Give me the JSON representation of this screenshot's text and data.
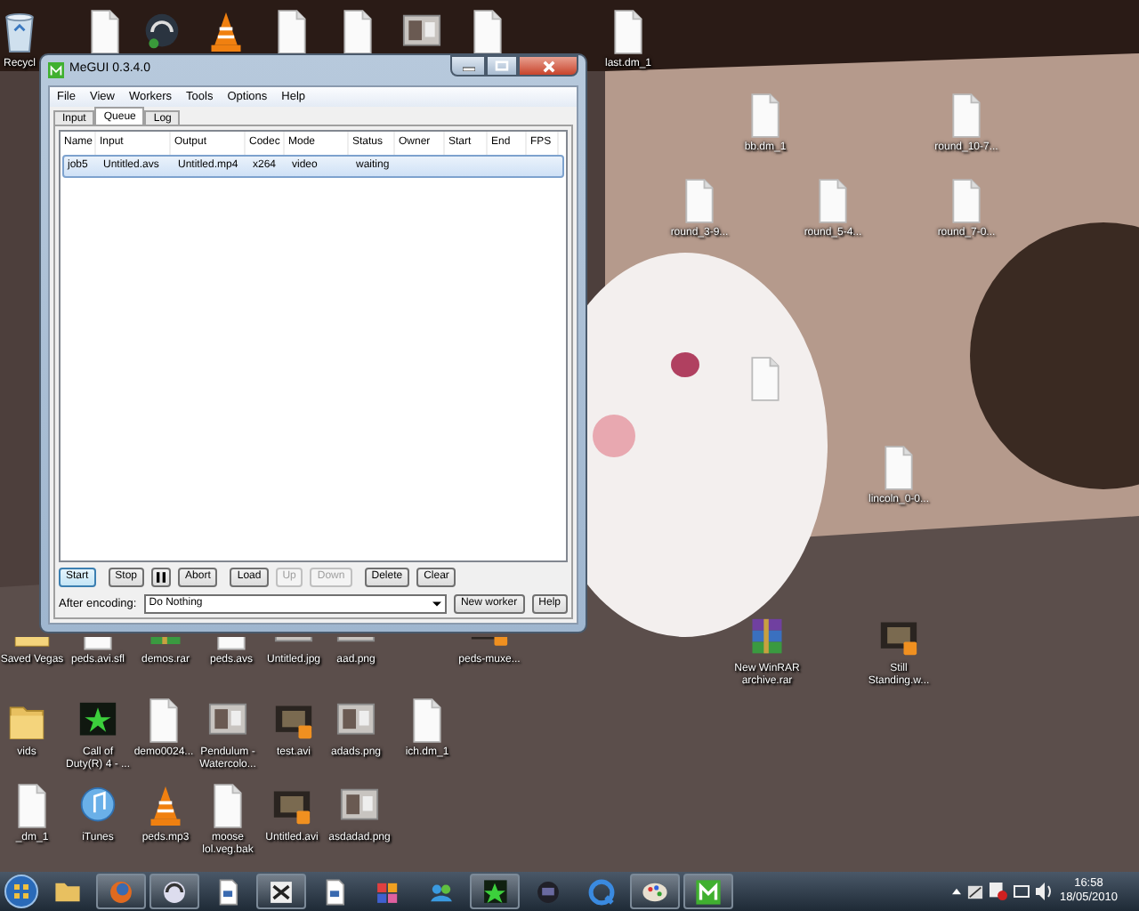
{
  "desktop_icons": [
    {
      "kind": "recycle",
      "label": "Recycl"
    },
    {
      "kind": "file"
    },
    {
      "kind": "headset"
    },
    {
      "kind": "vlc"
    },
    {
      "kind": "file"
    },
    {
      "kind": "file"
    },
    {
      "kind": "image"
    },
    {
      "kind": "file"
    },
    {
      "kind": "file",
      "label": "last.dm_1"
    },
    {
      "kind": "file",
      "label": "bb.dm_1"
    },
    {
      "kind": "file",
      "label": "round_10-7..."
    },
    {
      "kind": "file",
      "label": "round_3-9..."
    },
    {
      "kind": "file",
      "label": "round_5-4..."
    },
    {
      "kind": "file",
      "label": "round_7-0..."
    },
    {
      "kind": "file"
    },
    {
      "kind": "file",
      "label": "lincoln_0-0..."
    },
    {
      "kind": "winrar",
      "label": "New WinRAR archive.rar"
    },
    {
      "kind": "video",
      "label": "Still Standing.w..."
    },
    {
      "kind": "folder",
      "label": "Saved Vegas",
      "covered": true
    },
    {
      "kind": "file",
      "label": "peds.avi.sfl",
      "covered": true
    },
    {
      "kind": "winrar",
      "label": "demos.rar",
      "covered": true
    },
    {
      "kind": "file",
      "label": "peds.avs",
      "covered": true
    },
    {
      "kind": "image",
      "label": "Untitled.jpg",
      "covered": true
    },
    {
      "kind": "image",
      "label": "aad.png",
      "covered": true
    },
    {
      "kind": "video",
      "label": "peds-muxe...",
      "covered": true
    },
    {
      "kind": "folder",
      "label": "vids"
    },
    {
      "kind": "game",
      "label": "Call of Duty(R) 4 - ..."
    },
    {
      "kind": "file",
      "label": "demo0024..."
    },
    {
      "kind": "image",
      "label": "Pendulum - Watercolo..."
    },
    {
      "kind": "video",
      "label": "test.avi"
    },
    {
      "kind": "image",
      "label": "adads.png"
    },
    {
      "kind": "file",
      "label": "ich.dm_1"
    },
    {
      "kind": "file",
      "label": "_dm_1"
    },
    {
      "kind": "itunes",
      "label": "iTunes"
    },
    {
      "kind": "vlc",
      "label": "peds.mp3"
    },
    {
      "kind": "file",
      "label": "moose lol.veg.bak"
    },
    {
      "kind": "video",
      "label": "Untitled.avi"
    },
    {
      "kind": "image",
      "label": "asdadad.png"
    }
  ],
  "window": {
    "title": "MeGUI 0.3.4.0",
    "menu": [
      "File",
      "View",
      "Workers",
      "Tools",
      "Options",
      "Help"
    ],
    "tabs": [
      {
        "label": "Input",
        "selected": false
      },
      {
        "label": "Queue",
        "selected": true
      },
      {
        "label": "Log",
        "selected": false
      }
    ],
    "table": {
      "columns": [
        "Name",
        "Input",
        "Output",
        "Codec",
        "Mode",
        "Status",
        "Owner",
        "Start",
        "End",
        "FPS"
      ],
      "rows": [
        {
          "cells": [
            "job5",
            "Untitled.avs",
            "Untitled.mp4",
            "x264",
            "video",
            "waiting"
          ],
          "selected": true
        }
      ]
    },
    "buttons": [
      {
        "kind": "text",
        "label": "Start",
        "focused": true,
        "disabled": false
      },
      {
        "kind": "text",
        "label": "Stop",
        "focused": false,
        "disabled": false
      },
      {
        "kind": "pause",
        "focused": false,
        "disabled": false
      },
      {
        "kind": "text",
        "label": "Abort",
        "focused": false,
        "disabled": false
      },
      {
        "kind": "text",
        "label": "Load",
        "focused": false,
        "disabled": false
      },
      {
        "kind": "text",
        "label": "Up",
        "focused": false,
        "disabled": true
      },
      {
        "kind": "text",
        "label": "Down",
        "focused": false,
        "disabled": true
      },
      {
        "kind": "text",
        "label": "Delete",
        "focused": false,
        "disabled": false
      },
      {
        "kind": "text",
        "label": "Clear",
        "focused": false,
        "disabled": false
      }
    ],
    "after_encoding": {
      "label": "After encoding:",
      "value": "Do Nothing"
    },
    "side_buttons": [
      "New worker",
      "Help"
    ]
  },
  "taskbar": {
    "items": [
      {
        "kind": "folder",
        "running": false
      },
      {
        "kind": "firefox",
        "running": true
      },
      {
        "kind": "headset",
        "running": true
      },
      {
        "kind": "doc",
        "running": false
      },
      {
        "kind": "xapp",
        "running": true
      },
      {
        "kind": "doc",
        "running": false
      },
      {
        "kind": "blocks",
        "running": false
      },
      {
        "kind": "msn",
        "running": false
      },
      {
        "kind": "game",
        "running": true
      },
      {
        "kind": "media",
        "running": false
      },
      {
        "kind": "quicktime",
        "running": false
      },
      {
        "kind": "paint",
        "running": true
      },
      {
        "kind": "megui",
        "running": true
      }
    ],
    "clock": {
      "time": "16:58",
      "date": "18/05/2010"
    }
  }
}
